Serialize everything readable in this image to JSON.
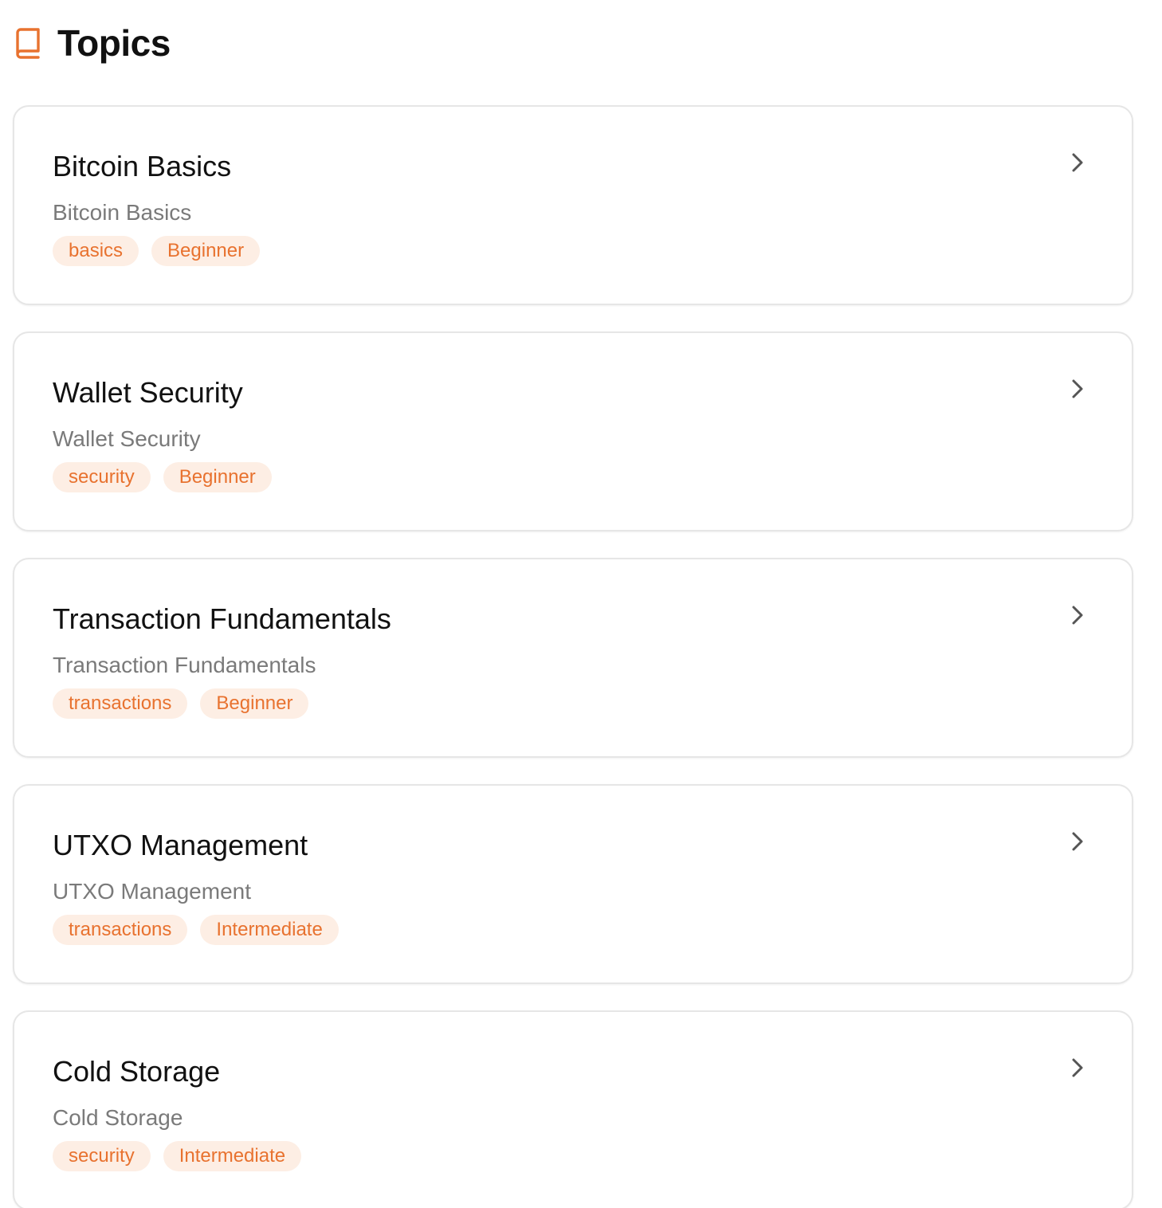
{
  "header": {
    "title": "Topics",
    "icon": "book-icon",
    "accent_color": "#E8722F"
  },
  "topics": [
    {
      "title": "Bitcoin Basics",
      "subtitle": "Bitcoin Basics",
      "tags": [
        "basics",
        "Beginner"
      ]
    },
    {
      "title": "Wallet Security",
      "subtitle": "Wallet Security",
      "tags": [
        "security",
        "Beginner"
      ]
    },
    {
      "title": "Transaction Fundamentals",
      "subtitle": "Transaction Fundamentals",
      "tags": [
        "transactions",
        "Beginner"
      ]
    },
    {
      "title": "UTXO Management",
      "subtitle": "UTXO Management",
      "tags": [
        "transactions",
        "Intermediate"
      ]
    },
    {
      "title": "Cold Storage",
      "subtitle": "Cold Storage",
      "tags": [
        "security",
        "Intermediate"
      ]
    }
  ]
}
